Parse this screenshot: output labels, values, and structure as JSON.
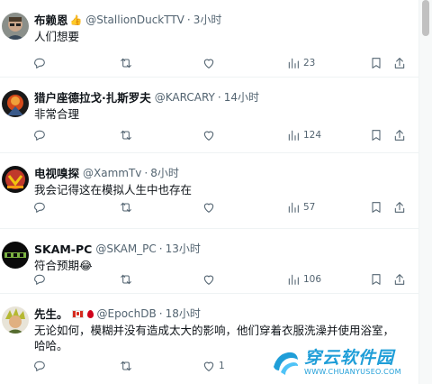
{
  "tweets": [
    {
      "name": "布赖恩",
      "emoji": "👍",
      "handle": "@StallionDuckTTV",
      "time": "3小时",
      "text": "人们想要",
      "views": "23",
      "avatar": "avatar-1"
    },
    {
      "name": "猎户座德拉戈·扎斯罗夫",
      "handle": "@KARCARY",
      "time": "14小时",
      "text": "非常合理",
      "views": "124",
      "avatar": "avatar-2"
    },
    {
      "name": "电视嗅探",
      "handle": "@XammTv",
      "time": "8小时",
      "text": "我会记得这在模拟人生中也存在",
      "views": "57",
      "avatar": "avatar-3"
    },
    {
      "name": "SKAM-PC",
      "handle": "@SKAM_PC",
      "time": "13小时",
      "text": "符合预期😂",
      "views": "106",
      "avatar": "avatar-4"
    },
    {
      "name": "先生。",
      "handle": "@EpochDB",
      "time": "18小时",
      "text": "无论如何，模糊并没有造成太大的影响，他们穿着衣服洗澡并使用浴室，哈哈。",
      "likes": "1",
      "avatar": "avatar-5"
    }
  ],
  "separator": "·",
  "watermark": {
    "title": "穿云软件园",
    "url": "WWW.CHUANYUSEO.COM"
  },
  "colors": {
    "text": "#0f1419",
    "secondary": "#536471",
    "border": "#eff3f4",
    "watermark": "#1f9ed8"
  }
}
